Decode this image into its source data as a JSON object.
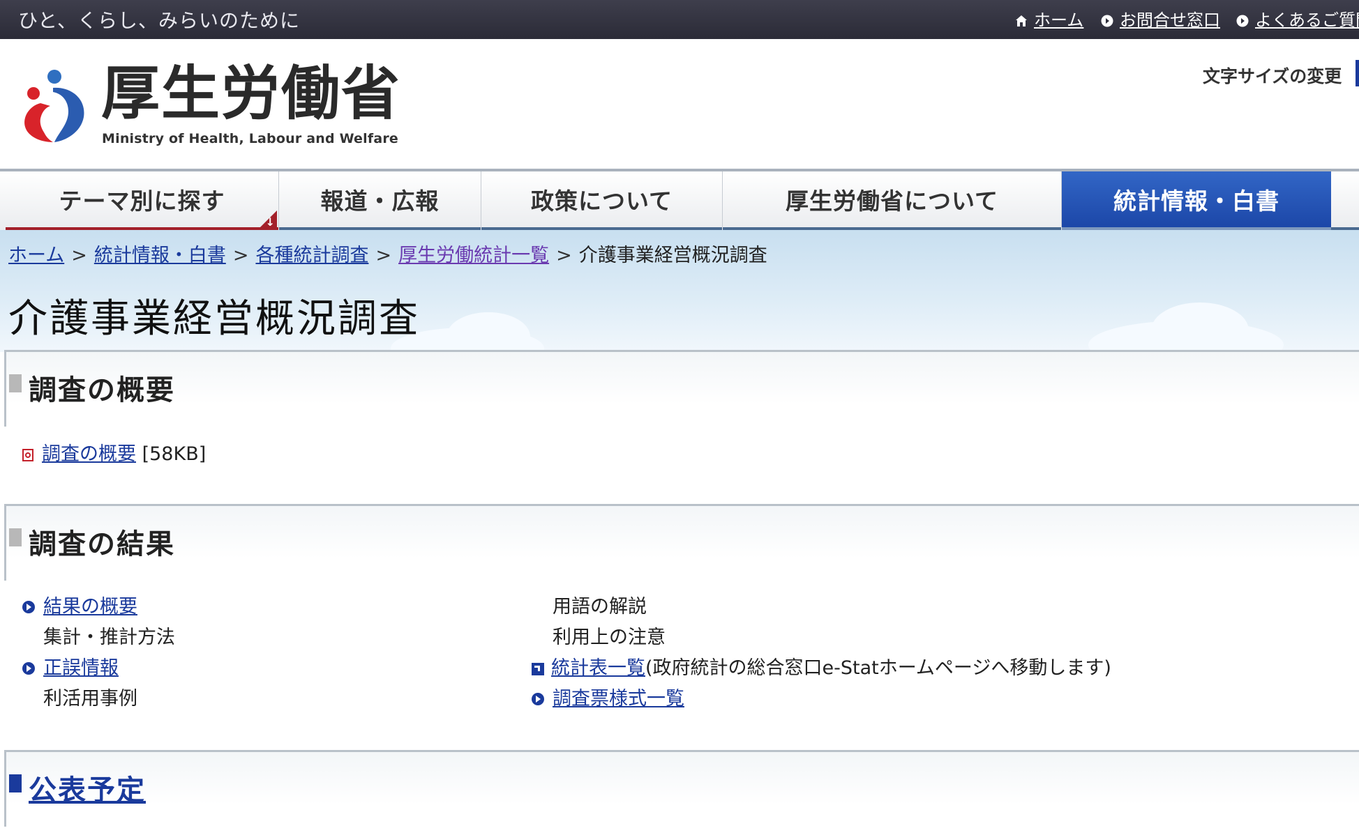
{
  "header": {
    "tagline": "ひと、くらし、みらいのために",
    "links": [
      {
        "label": "ホーム",
        "icon": "home-icon"
      },
      {
        "label": "お問合せ窓口",
        "icon": "arrow-circle-icon"
      },
      {
        "label": "よくあるご質問",
        "icon": "arrow-circle-icon"
      }
    ],
    "logo_title": "厚生労働省",
    "logo_subtitle": "Ministry of Health, Labour and Welfare",
    "font_size_label": "文字サイズの変更"
  },
  "nav": {
    "items": [
      {
        "label": "テーマ別に探す"
      },
      {
        "label": "報道・広報"
      },
      {
        "label": "政策について"
      },
      {
        "label": "厚生労働省について"
      },
      {
        "label": "統計情報・白書"
      }
    ],
    "active": "統計情報・白書"
  },
  "breadcrumb": {
    "items": [
      {
        "label": "ホーム",
        "link": true
      },
      {
        "label": "統計情報・白書",
        "link": true
      },
      {
        "label": "各種統計調査",
        "link": true
      },
      {
        "label": "厚生労働統計一覧",
        "link": true
      },
      {
        "label": "介護事業経営概況調査",
        "link": false
      }
    ],
    "separator": ">"
  },
  "page_title": "介護事業経営概況調査",
  "sections": {
    "overview": {
      "heading": "調査の概要",
      "doc_link": "調査の概要",
      "doc_size": "[58KB]"
    },
    "results": {
      "heading": "調査の結果",
      "left_items": [
        {
          "label": "結果の概要",
          "link": true
        },
        {
          "label": "集計・推計方法",
          "link": false
        },
        {
          "label": "正誤情報",
          "link": true
        },
        {
          "label": "利活用事例",
          "link": false
        }
      ],
      "right_items": [
        {
          "label": "用語の解説",
          "link": false
        },
        {
          "label": "利用上の注意",
          "link": false
        },
        {
          "label": "統計表一覧",
          "link": true,
          "note": "(政府統計の総合窓口e-Statホームページへ移動します)"
        },
        {
          "label": "調査票様式一覧",
          "link": true
        }
      ]
    },
    "schedule": {
      "heading": "公表予定"
    }
  },
  "colors": {
    "topbar": "#2f2f3b",
    "nav_active": "#1f4aa8",
    "link": "#1a3a9c",
    "theme_accent": "#a3202a"
  }
}
